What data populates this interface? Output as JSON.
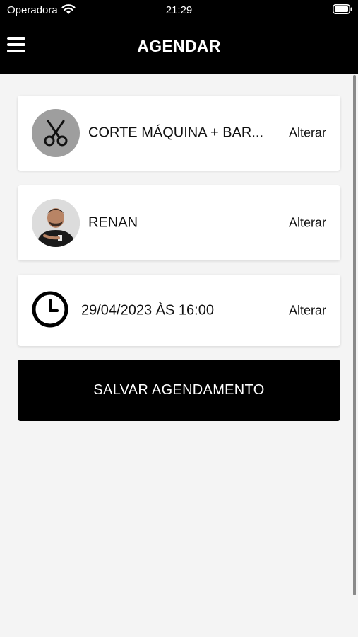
{
  "status_bar": {
    "carrier": "Operadora",
    "time": "21:29"
  },
  "header": {
    "title": "AGENDAR"
  },
  "service": {
    "label": "CORTE MÁQUINA + BAR...",
    "change": "Alterar"
  },
  "barber": {
    "label": "RENAN",
    "change": "Alterar"
  },
  "datetime": {
    "label": "29/04/2023 ÀS 16:00",
    "change": "Alterar"
  },
  "save_button": {
    "label": "SALVAR AGENDAMENTO"
  },
  "colors": {
    "header_bg": "#000000",
    "page_bg": "#f4f4f4",
    "card_bg": "#ffffff",
    "button_bg": "#000000"
  }
}
